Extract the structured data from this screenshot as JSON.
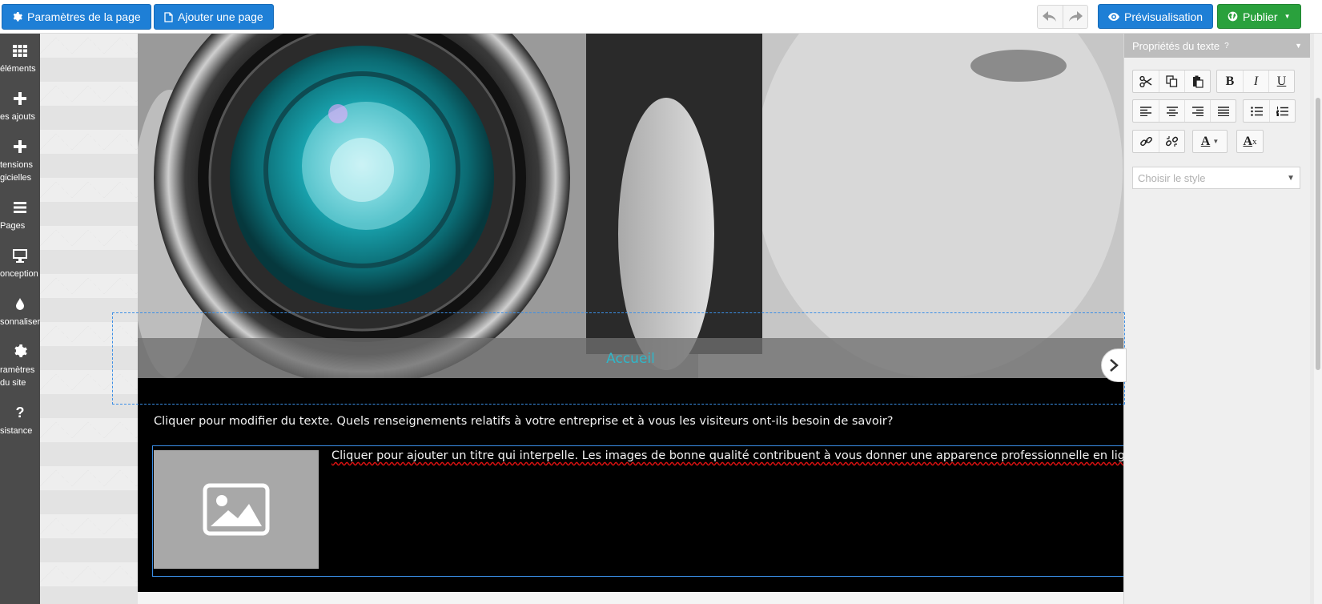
{
  "toolbar": {
    "page_settings_label": "Paramètres de la page",
    "add_page_label": "Ajouter une page",
    "preview_label": "Prévisualisation",
    "publish_label": "Publier"
  },
  "sidebar": {
    "items": [
      {
        "label_line1": "éléments",
        "label_line2": ""
      },
      {
        "label_line1": "es ajouts",
        "label_line2": ""
      },
      {
        "label_line1": "tensions",
        "label_line2": "gicielles"
      },
      {
        "label_line1": "Pages",
        "label_line2": ""
      },
      {
        "label_line1": "onception",
        "label_line2": ""
      },
      {
        "label_line1": "sonnaliser",
        "label_line2": ""
      },
      {
        "label_line1": "ramètres",
        "label_line2": "du site"
      },
      {
        "label_line1": "sistance",
        "label_line2": ""
      }
    ]
  },
  "canvas": {
    "nav_label": "Accueil",
    "body_text": "Cliquer pour modifier du texte. Quels renseignements relatifs à votre entreprise et à vous les visiteurs ont-ils besoin de savoir?",
    "block_text": "Cliquer pour ajouter un titre qui interpelle. Les images de bonne qualité contribuent à vous donner une apparence professionnelle en ligne."
  },
  "panel": {
    "title": "Propriétés du texte",
    "help": "?",
    "style_placeholder": "Choisir le style",
    "bold": "B",
    "italic": "I",
    "underline": "U",
    "font_color": "A",
    "clear_format": "A",
    "clear_format_sub": "x"
  },
  "colors": {
    "primary_blue": "#1e7fd6",
    "publish_green": "#2aa13d",
    "nav_accent": "#2fb7c9",
    "selection_blue": "#3a8ee6"
  }
}
